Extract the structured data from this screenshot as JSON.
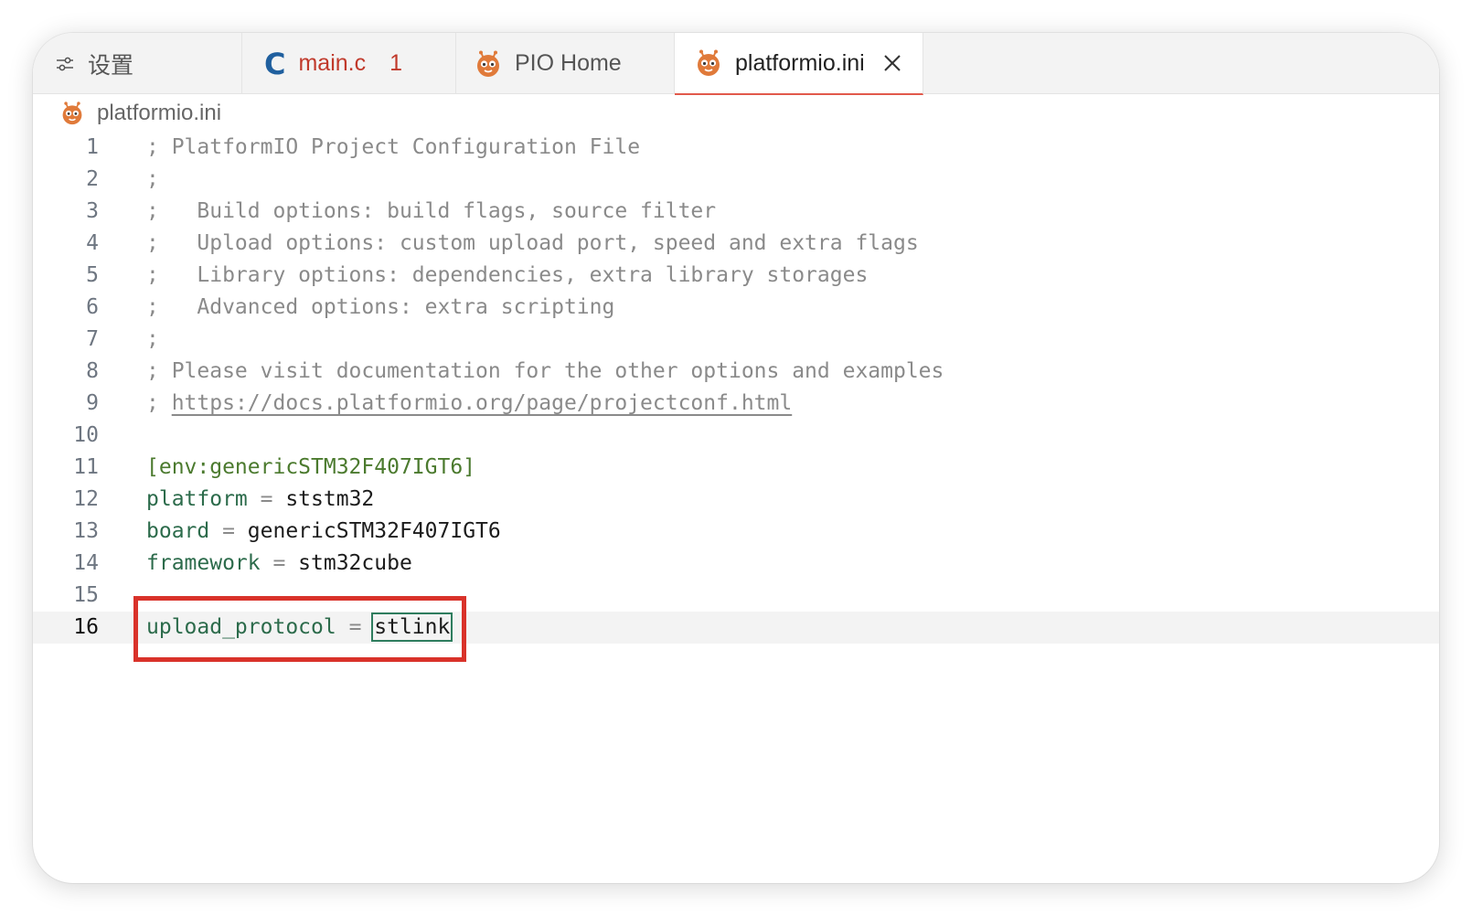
{
  "tabs": {
    "settings_label": "设置",
    "main_c": {
      "icon": "c-language-icon",
      "label": "main.c",
      "problem_count": "1"
    },
    "pio_home": {
      "icon": "platformio-icon",
      "label": "PIO Home"
    },
    "platformio_ini": {
      "icon": "platformio-icon",
      "label": "platformio.ini",
      "active": true
    }
  },
  "breadcrumb": {
    "file": "platformio.ini"
  },
  "editor": {
    "current_line": 16,
    "lines": [
      {
        "n": "1",
        "comment": "; PlatformIO Project Configuration File"
      },
      {
        "n": "2",
        "comment": ";"
      },
      {
        "n": "3",
        "comment": ";   Build options: build flags, source filter"
      },
      {
        "n": "4",
        "comment": ";   Upload options: custom upload port, speed and extra flags"
      },
      {
        "n": "5",
        "comment": ";   Library options: dependencies, extra library storages"
      },
      {
        "n": "6",
        "comment": ";   Advanced options: extra scripting"
      },
      {
        "n": "7",
        "comment": ";"
      },
      {
        "n": "8",
        "comment": "; Please visit documentation for the other options and examples"
      },
      {
        "n": "9",
        "comment_prefix": "; ",
        "link": "https://docs.platformio.org/page/projectconf.html"
      },
      {
        "n": "10"
      },
      {
        "n": "11",
        "section": "[env:genericSTM32F407IGT6]"
      },
      {
        "n": "12",
        "key": "platform",
        "eq": " = ",
        "value": "ststm32"
      },
      {
        "n": "13",
        "key": "board",
        "eq": " = ",
        "value": "genericSTM32F407IGT6"
      },
      {
        "n": "14",
        "key": "framework",
        "eq": " = ",
        "value": "stm32cube"
      },
      {
        "n": "15"
      },
      {
        "n": "16",
        "key": "upload_protocol",
        "eq": " = ",
        "value": "stlink"
      }
    ]
  },
  "colors": {
    "annotation_box": "#d9322a",
    "comment": "#8a8a8a",
    "section": "#4b7a2e",
    "key": "#2c6b4b",
    "active_tab_underline": "#e2594b"
  }
}
